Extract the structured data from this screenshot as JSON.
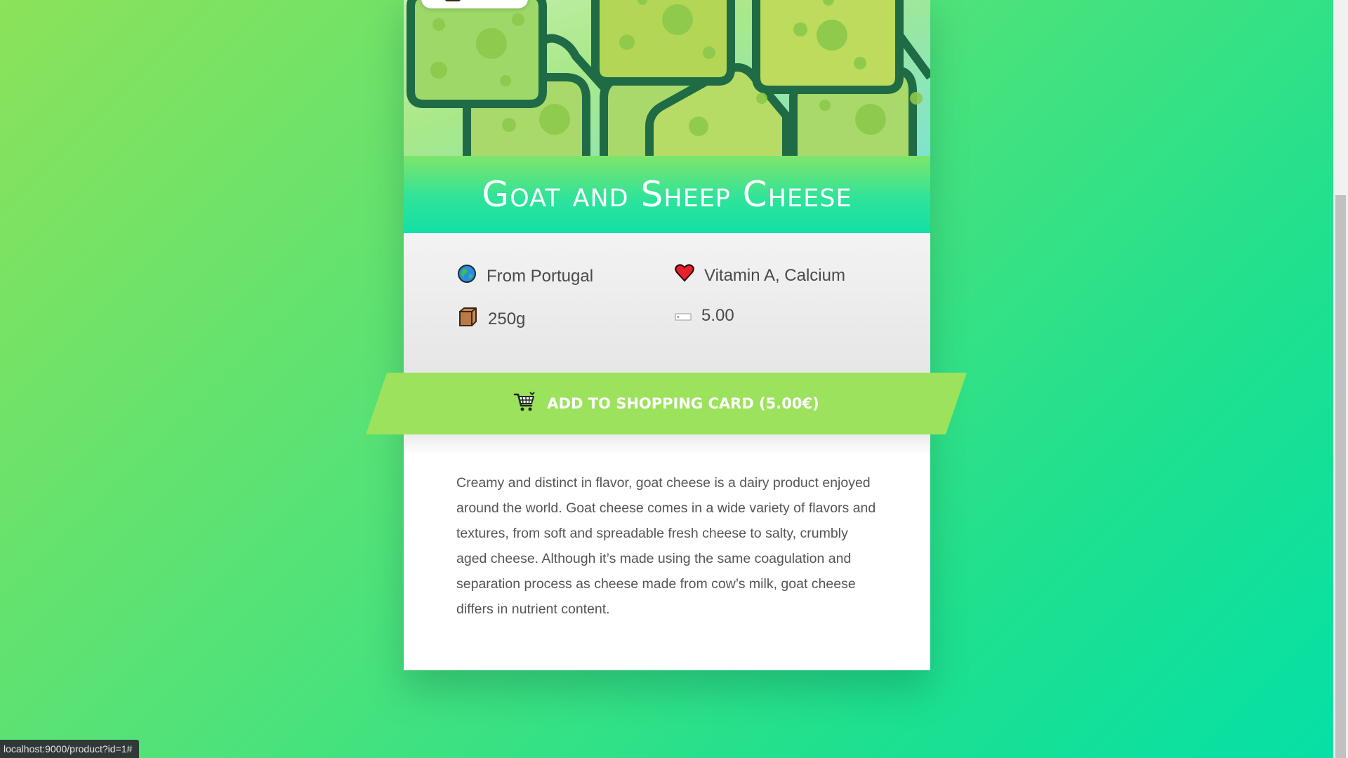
{
  "product": {
    "title": "Goat and Sheep Cheese",
    "facts": {
      "origin": "From Portugal",
      "nutrients": "Vitamin A, Calcium",
      "weight": "250g",
      "price": "5.00"
    },
    "cart_button_label": "ADD TO SHOPPING CARD (5.00€)",
    "description": "Creamy and distinct in flavor, goat cheese is a dairy product enjoyed around the world. Goat cheese comes in a wide variety of flavors and textures, from soft and spreadable fresh cheese to salty, crumbly aged cheese. Although it’s made using the same coagulation and separation process as cheese made from cow’s milk, goat cheese differs in nutrient content."
  },
  "icons": {
    "origin": "globe-icon",
    "nutrients": "heart-icon",
    "weight": "package-icon",
    "price": "price-tag-icon",
    "cart": "shopping-cart-icon"
  },
  "colors": {
    "cart_button": "#9ce25c",
    "title_text": "#ffffff"
  },
  "status_bar": {
    "url": "localhost:9000/product?id=1#"
  }
}
